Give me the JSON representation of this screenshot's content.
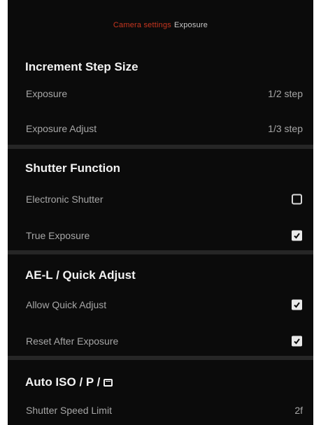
{
  "header": {
    "crumb_root": "Camera settings",
    "crumb_current": "Exposure"
  },
  "sections": [
    {
      "title": "Increment Step Size",
      "rows": [
        {
          "label": "Exposure",
          "value": "1/2 step"
        },
        {
          "label": "Exposure Adjust",
          "value": "1/3 step"
        }
      ]
    },
    {
      "title": "Shutter Function",
      "rows": [
        {
          "label": "Electronic Shutter",
          "checked": false
        },
        {
          "label": "True Exposure",
          "checked": true
        }
      ]
    },
    {
      "title": "AE-L / Quick Adjust",
      "rows": [
        {
          "label": "Allow Quick Adjust",
          "checked": true
        },
        {
          "label": "Reset After Exposure",
          "checked": true
        }
      ]
    },
    {
      "title": "Auto ISO / P /",
      "title_icon": "frame-mode-icon",
      "rows": [
        {
          "label": "Shutter Speed Limit",
          "value": "2f"
        }
      ]
    }
  ],
  "colors": {
    "background": "#0b0b0b",
    "breadcrumb_accent": "#c8361f",
    "divider": "#262626",
    "label_text": "#a7a7a7"
  }
}
